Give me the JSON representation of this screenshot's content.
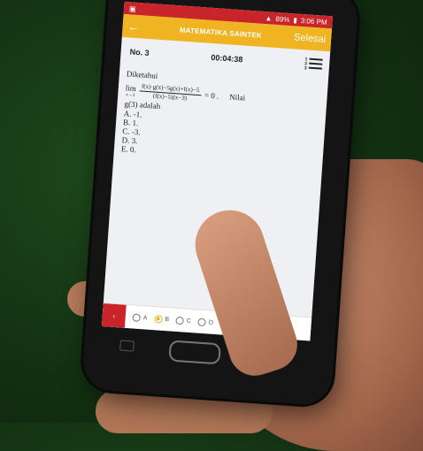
{
  "status_bar": {
    "left_icon": "notification-icon",
    "battery": "89%",
    "time": "3:06 PM"
  },
  "app_bar": {
    "title": "MATEMATIKA SAINTEK",
    "done_label": "Selesai"
  },
  "question_header": {
    "number": "No. 3",
    "timer": "00:04:38"
  },
  "question": {
    "intro": "Diketahui",
    "limit": "lim",
    "limit_sub": "x→3",
    "numerator": "f(x)·g(x)−5g(x)+f(x)−5",
    "denominator": "(f(x)−5)(x−3)",
    "equals": "= 0 .",
    "tail": "Nilai",
    "ask": "g(3) adalah",
    "options": [
      "A. -1.",
      "B. 1.",
      "C. -3.",
      "D. 3.",
      "E. 0."
    ]
  },
  "answer_nav": {
    "prev_label": "‹",
    "choices": [
      "A",
      "B",
      "C",
      "D"
    ],
    "selected": "B"
  }
}
